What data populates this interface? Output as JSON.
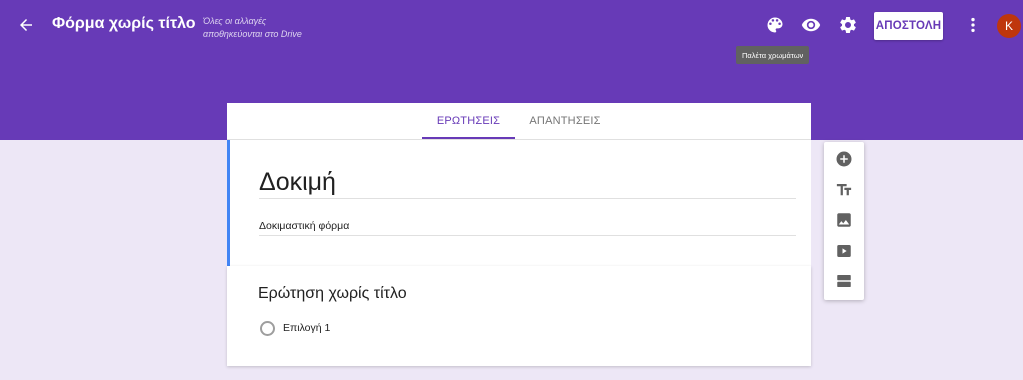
{
  "header": {
    "back_icon": "arrow-back-icon",
    "form_title": "Φόρμα χωρίς τίτλο",
    "save_status_line1": "Όλες οι αλλαγές",
    "save_status_line2": "αποθηκεύονται στο Drive",
    "palette_icon": "palette-icon",
    "preview_icon": "eye-icon",
    "settings_icon": "gear-icon",
    "send_label": "ΑΠΟΣΤΟΛΗ",
    "more_icon": "more-vert-icon",
    "avatar_letter": "K",
    "tooltip": "Παλέτα χρωμάτων",
    "colors": {
      "brand": "#673ab7",
      "avatar": "#bf360c",
      "accent_border": "#4285f4"
    }
  },
  "tabs": [
    {
      "label": "ΕΡΩΤΗΣΕΙΣ",
      "active": true
    },
    {
      "label": "ΑΠΑΝΤΗΣΕΙΣ",
      "active": false
    }
  ],
  "form": {
    "title": "Δοκιμή",
    "description": "Δοκιμαστική φόρμα"
  },
  "question": {
    "title": "Ερώτηση χωρίς τίτλο",
    "options": [
      "Επιλογή 1"
    ]
  },
  "toolbar": {
    "items": [
      "add-circle-icon",
      "title-text-icon",
      "image-icon",
      "video-icon",
      "section-icon"
    ]
  }
}
